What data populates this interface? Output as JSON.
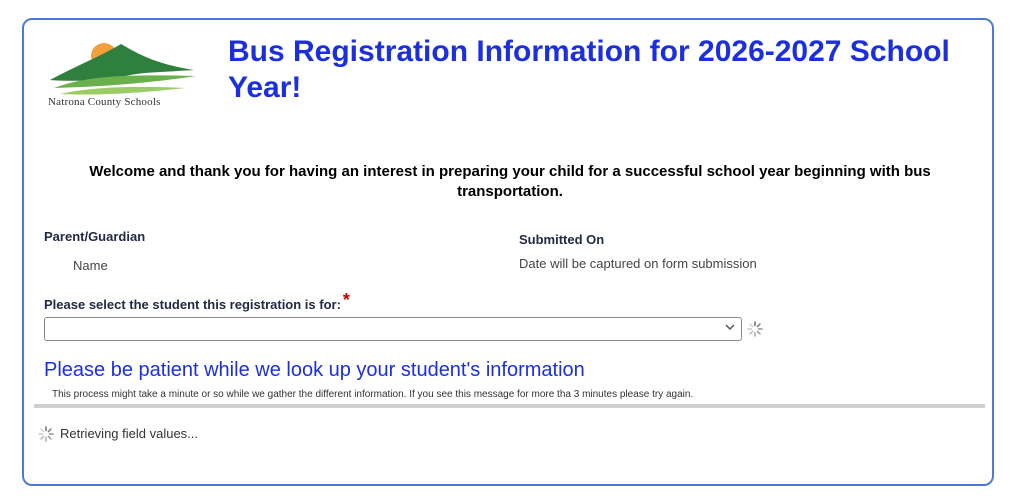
{
  "header": {
    "logo_text": "Natrona County Schools",
    "title": "Bus Registration Information for 2026-2027 School Year!"
  },
  "welcome": "Welcome and thank you for having an interest in preparing your child for a successful school year beginning with bus transportation.",
  "parent": {
    "label": "Parent/Guardian",
    "value": "Name"
  },
  "submitted": {
    "label": "Submitted On",
    "value": "Date will be captured on form submission"
  },
  "student_select": {
    "label": "Please select the student this registration is for:",
    "required_mark": "*",
    "value": ""
  },
  "status": {
    "heading": "Please be patient while we look up your student's information",
    "detail": "This process might take a minute or so while we gather the different information. If you see this message for more tha 3 minutes please try again.",
    "retrieving": "Retrieving field values..."
  },
  "colors": {
    "title": "#1c2fe0",
    "frame_border": "#4a7bd8",
    "required": "#cc0000"
  },
  "icons": {
    "select_chevron": "chevron-down-icon",
    "spinner": "loading-spinner-icon"
  }
}
